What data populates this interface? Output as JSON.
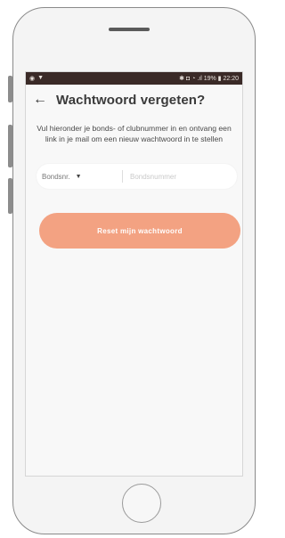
{
  "status_bar": {
    "left_icons": [
      "◉",
      "▼"
    ],
    "right_text": "✱ ◘ ◔ .ıl 19% ▮ 22:20"
  },
  "app_bar": {
    "back_glyph": "←",
    "title": "Wachtwoord vergeten?"
  },
  "description": "Vul hieronder je bonds- of clubnummer in en ontvang een link in je mail om een nieuw wachtwoord in te stellen",
  "form": {
    "type_select_value": "Bondsnr.",
    "type_select_arrow": "▼",
    "number_placeholder": "Bondsnummer"
  },
  "submit_label": "Reset mijn wachtwoord",
  "colors": {
    "status_bar_bg": "#3a2a27",
    "accent": "#f3a282"
  }
}
